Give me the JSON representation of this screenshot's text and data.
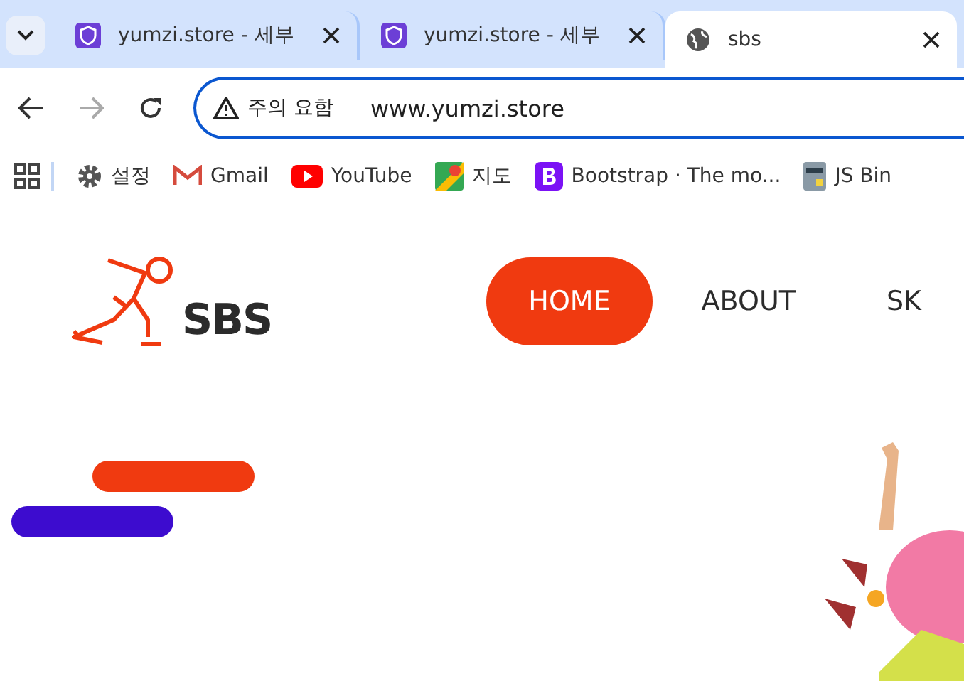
{
  "tabs": [
    {
      "title": "yumzi.store - 세부",
      "selected": false,
      "kind": "badge"
    },
    {
      "title": "yumzi.store - 세부",
      "selected": false,
      "kind": "badge"
    },
    {
      "title": "sbs",
      "selected": true,
      "kind": "globe"
    }
  ],
  "address_bar": {
    "warning": "주의 요함",
    "url": "www.yumzi.store"
  },
  "bookmarks": [
    {
      "label": "설정",
      "kind": "gear"
    },
    {
      "label": "Gmail",
      "kind": "mail"
    },
    {
      "label": "YouTube",
      "kind": "video"
    },
    {
      "label": "지도",
      "kind": "map"
    },
    {
      "label": "Bootstrap · The mo...",
      "kind": "bootstrap"
    },
    {
      "label": "JS Bin",
      "kind": "bin"
    }
  ],
  "site": {
    "logo": "SBS",
    "nav": [
      {
        "label": "HOME",
        "selected": true
      },
      {
        "label": "ABOUT",
        "selected": false
      },
      {
        "label": "SK",
        "selected": false
      }
    ]
  }
}
